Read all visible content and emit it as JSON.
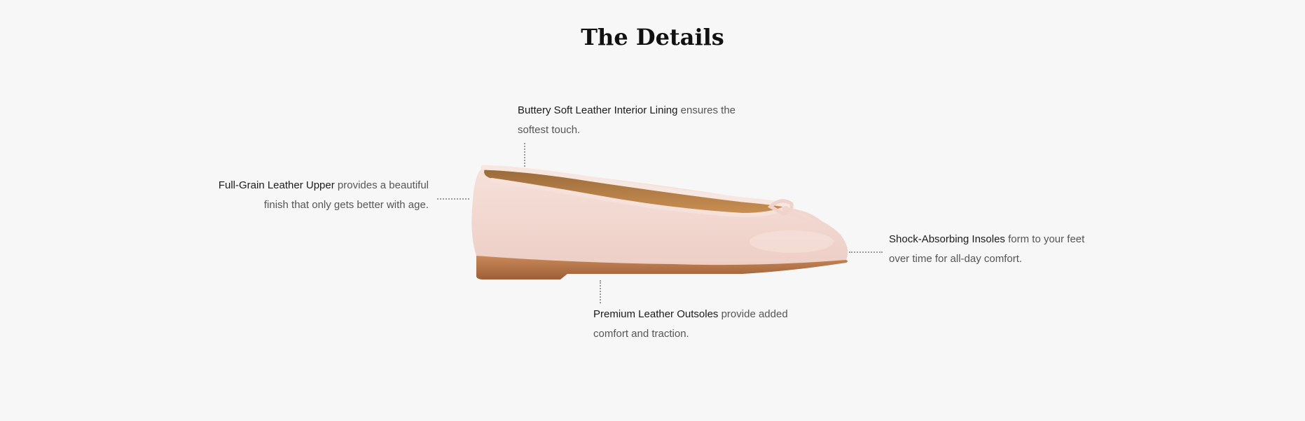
{
  "section": {
    "title": "The Details"
  },
  "features": {
    "lining": {
      "name": "Buttery Soft Leather Interior Lining",
      "desc": " ensures the softest touch."
    },
    "upper": {
      "name": "Full-Grain Leather Upper",
      "desc": " provides a beautiful finish that only gets better with age."
    },
    "insoles": {
      "name": "Shock-Absorbing Insoles",
      "desc": " form to your feet over time for all-day comfort."
    },
    "outsoles": {
      "name": "Premium Leather Outsoles",
      "desc": " provide added comfort and traction."
    }
  },
  "colors": {
    "background": "#f7f7f7",
    "shoe_leather": "#f2d7cf",
    "sole": "#b7744a"
  }
}
